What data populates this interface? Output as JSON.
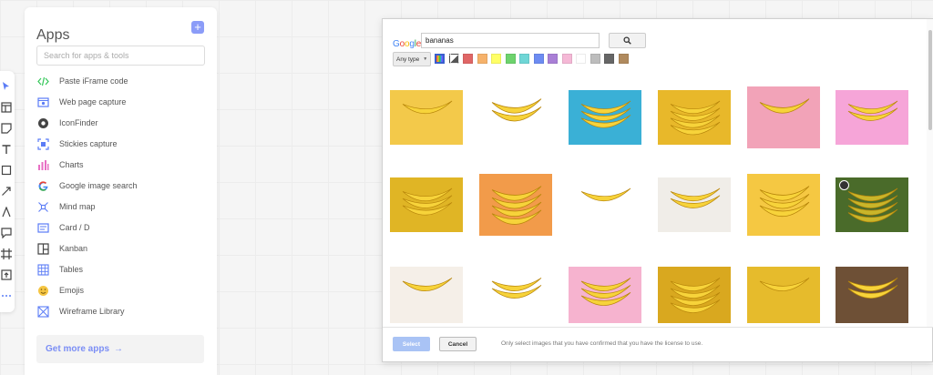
{
  "apps_panel": {
    "title": "Apps",
    "add_label": "+",
    "search_placeholder": "Search for apps & tools",
    "items": [
      {
        "label": "Paste iFrame code",
        "icon": "code-icon",
        "color": "#34c759"
      },
      {
        "label": "Web page capture",
        "icon": "webpage-capture-icon",
        "color": "#5b7cf6"
      },
      {
        "label": "IconFinder",
        "icon": "iconfinder-icon",
        "color": "#333333"
      },
      {
        "label": "Stickies capture",
        "icon": "stickies-capture-icon",
        "color": "#5b7cf6"
      },
      {
        "label": "Charts",
        "icon": "chart-bars-icon",
        "color": "#e86fc4"
      },
      {
        "label": "Google image search",
        "icon": "google-icon",
        "color": "#4285f4"
      },
      {
        "label": "Mind map",
        "icon": "mind-map-icon",
        "color": "#5b7cf6"
      },
      {
        "label": "Card / D",
        "icon": "card-icon",
        "color": "#5b7cf6"
      },
      {
        "label": "Kanban",
        "icon": "kanban-icon",
        "color": "#333333"
      },
      {
        "label": "Tables",
        "icon": "table-icon",
        "color": "#5b7cf6"
      },
      {
        "label": "Emojis",
        "icon": "emoji-icon",
        "color": "#f5c542"
      },
      {
        "label": "Wireframe Library",
        "icon": "wireframe-icon",
        "color": "#5b7cf6"
      }
    ],
    "more_apps_label": "Get more apps",
    "more_apps_arrow": "→"
  },
  "toolbar": {
    "tools": [
      "pointer-icon",
      "layout-icon",
      "sticky-note-icon",
      "text-icon",
      "rectangle-icon",
      "arrow-line-icon",
      "pen-icon",
      "comment-icon",
      "frame-icon",
      "upload-icon",
      "more-icon"
    ]
  },
  "image_search": {
    "logo_letters": [
      "G",
      "o",
      "o",
      "g",
      "l",
      "e"
    ],
    "query": "bananas",
    "search_icon": "magnifier-icon",
    "type_filter": "Any type",
    "color_filters": [
      "multicolor",
      "grayscale",
      "#e06666",
      "#f6b26b",
      "#ffff66",
      "#6dd36d",
      "#6fd6d6",
      "#6d8cf2",
      "#a97fd6",
      "#f5b8d6",
      "#ffffff",
      "#bdbdbd",
      "#666666",
      "#b08a5e"
    ],
    "selected_color_filter": "multicolor",
    "results": [
      {
        "desc": "bananas on plate",
        "bg": "#f3c94a",
        "checked": false
      },
      {
        "desc": "banana bunch",
        "bg": "#ffffff",
        "checked": false
      },
      {
        "desc": "banana bunch blue",
        "bg": "#3ab0d6",
        "checked": false
      },
      {
        "desc": "many bananas",
        "bg": "#e8b82a",
        "checked": false
      },
      {
        "desc": "bananas pink pattern",
        "bg": "#f2a3b8",
        "checked": false
      },
      {
        "desc": "banana pink",
        "bg": "#f6a5d8",
        "checked": false
      },
      {
        "desc": "banana pile",
        "bg": "#e0b525",
        "checked": false
      },
      {
        "desc": "peeled banana slices",
        "bg": "#f29b4a",
        "checked": false
      },
      {
        "desc": "single banana",
        "bg": "#ffffff",
        "checked": false
      },
      {
        "desc": "bananas on wood",
        "bg": "#f0ede8",
        "checked": false
      },
      {
        "desc": "peeled banana",
        "bg": "#f5c842",
        "checked": false
      },
      {
        "desc": "banana tree",
        "bg": "#4a6b2a",
        "checked": true
      },
      {
        "desc": "banana bunch plate",
        "bg": "#f5efe8",
        "checked": false
      },
      {
        "desc": "peeled banana heart",
        "bg": "#ffffff",
        "checked": false
      },
      {
        "desc": "bananas pink pattern",
        "bg": "#f6b3cf",
        "checked": false
      },
      {
        "desc": "hanging bananas",
        "bg": "#d9a81f",
        "checked": false
      },
      {
        "desc": "banana bunches",
        "bg": "#e6bb2c",
        "checked": false
      },
      {
        "desc": "bananas on table",
        "bg": "#6e5036",
        "checked": false
      }
    ],
    "select_label": "Select",
    "cancel_label": "Cancel",
    "license_note": "Only select images that you have confirmed that you have the license to use."
  }
}
